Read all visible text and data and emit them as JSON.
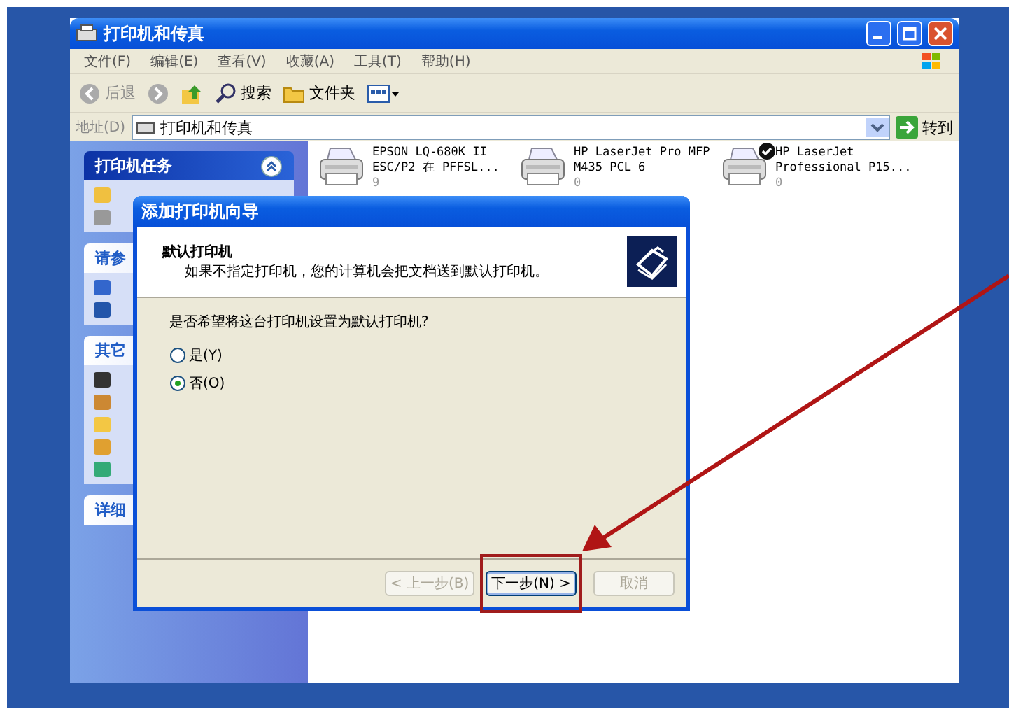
{
  "window": {
    "title": "打印机和传真",
    "menu": [
      "文件(F)",
      "编辑(E)",
      "查看(V)",
      "收藏(A)",
      "工具(T)",
      "帮助(H)"
    ],
    "toolbar": {
      "back": "后退",
      "search": "搜索",
      "folders": "文件夹"
    },
    "address": {
      "label": "地址(D)",
      "value": "打印机和传真",
      "go": "转到"
    }
  },
  "sidebar": {
    "panels": [
      {
        "title": "打印机任务",
        "expanded": true
      },
      {
        "title": "请参"
      },
      {
        "title": "其它"
      },
      {
        "title": "详细"
      }
    ]
  },
  "printers": [
    {
      "name_lines": [
        "EPSON LQ-680K II",
        "ESC/P2 在 PFFSL..."
      ],
      "count": "9",
      "default": false
    },
    {
      "name_lines": [
        "HP LaserJet Pro MFP",
        "M435 PCL 6"
      ],
      "count": "0",
      "default": false
    },
    {
      "name_lines": [
        "HP LaserJet",
        "Professional P15..."
      ],
      "count": "0",
      "default": true
    }
  ],
  "dialog": {
    "title": "添加打印机向导",
    "heading": "默认打印机",
    "subtitle": "如果不指定打印机，您的计算机会把文档送到默认打印机。",
    "question": "是否希望将这台打印机设置为默认打印机?",
    "options": [
      {
        "label": "是(Y)",
        "selected": false
      },
      {
        "label": "否(O)",
        "selected": true
      }
    ],
    "buttons": [
      {
        "label": "< 上一步(B)",
        "disabled": true,
        "highlighted": false
      },
      {
        "label": "下一步(N) >",
        "disabled": false,
        "highlighted": true
      },
      {
        "label": "取消",
        "disabled": true,
        "highlighted": false
      }
    ]
  }
}
